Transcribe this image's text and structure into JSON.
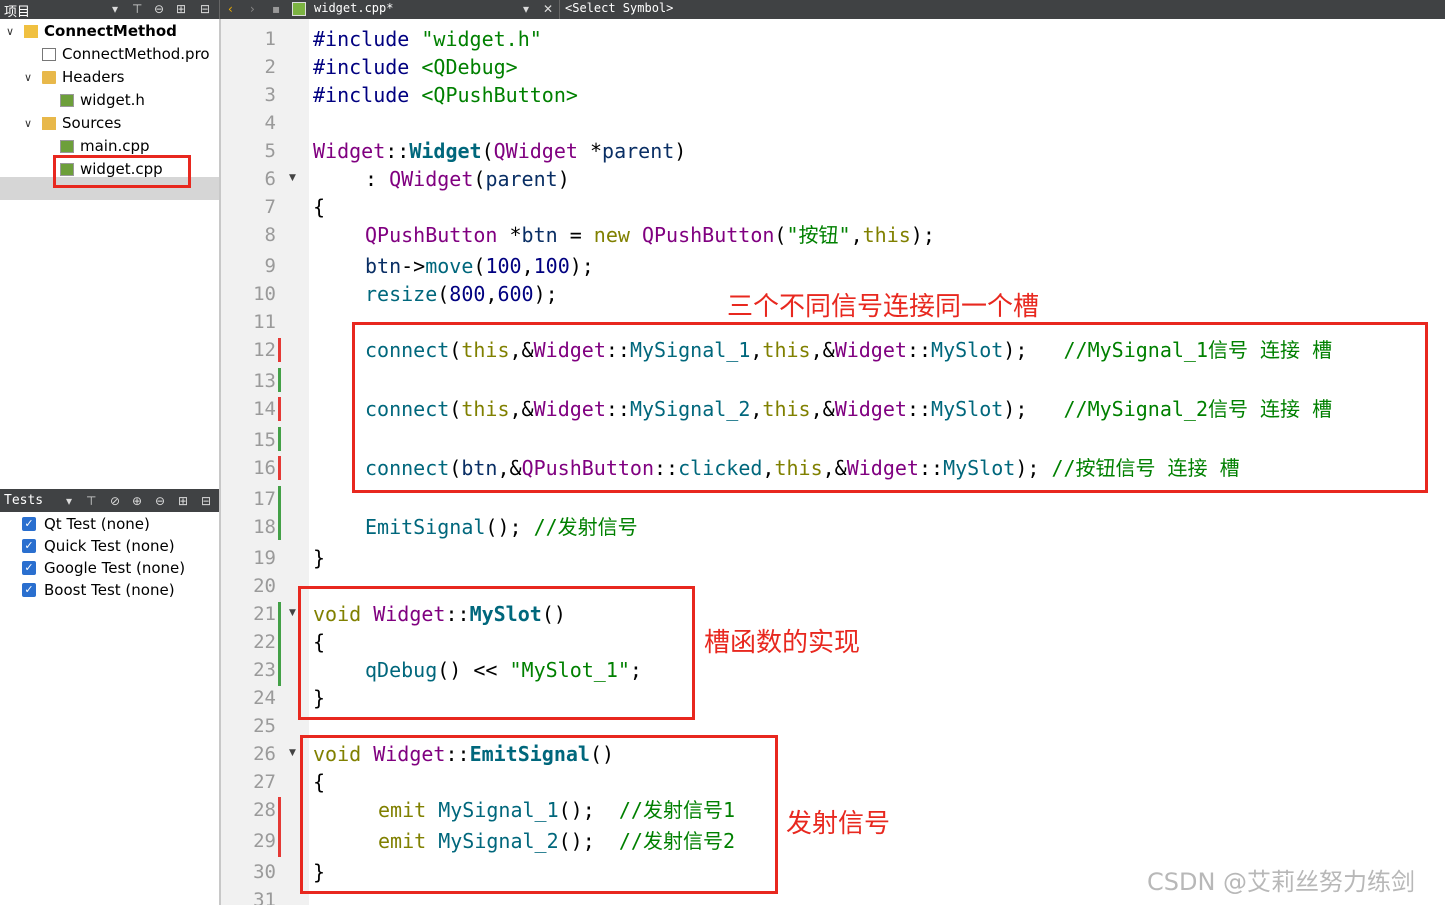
{
  "topbar": {
    "project_label": "项目",
    "file_name": "widget.cpp*",
    "symbol_select": "<Select Symbol>"
  },
  "tree": {
    "project": "ConnectMethod",
    "pro_file": "ConnectMethod.pro",
    "headers": "Headers",
    "header_file": "widget.h",
    "sources": "Sources",
    "source_main": "main.cpp",
    "source_widget": "widget.cpp"
  },
  "tests": {
    "label": "Tests",
    "items": [
      "Qt Test (none)",
      "Quick Test (none)",
      "Google Test (none)",
      "Boost Test (none)"
    ]
  },
  "editor": {
    "line_numbers": [
      "1",
      "2",
      "3",
      "4",
      "5",
      "6",
      "7",
      "8",
      "9",
      "10",
      "11",
      "12",
      "13",
      "14",
      "15",
      "16",
      "17",
      "18",
      "19",
      "20",
      "21",
      "22",
      "23",
      "24",
      "25",
      "26",
      "27",
      "28",
      "29",
      "30",
      "31"
    ]
  },
  "annotations": {
    "connect_note": "三个不同信号连接同一个槽",
    "slot_note": "槽函数的实现",
    "emit_note": "发射信号"
  },
  "watermark": "CSDN @艾莉丝努力练剑",
  "colors": {
    "annotation_red": "#e8281f",
    "topbar_bg": "#404244",
    "gutter_bg": "#f1f1f1"
  }
}
